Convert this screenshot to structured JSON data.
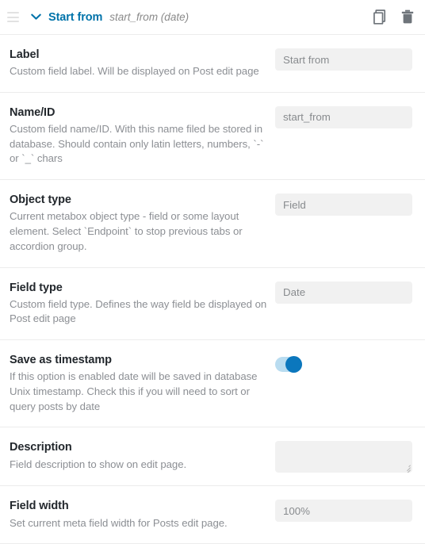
{
  "header": {
    "drag_handle_icon": "drag-handle-icon",
    "collapse_icon": "chevron-down-icon",
    "title": "Start from",
    "subtitle": "start_from (date)",
    "duplicate_icon": "duplicate-icon",
    "delete_icon": "trash-icon",
    "title_color": "#0073aa",
    "subtitle_color": "#8a8a8a"
  },
  "rows": [
    {
      "label": "Label",
      "description": "Custom field label. Will be displayed on Post edit page",
      "control": "text",
      "name": "label",
      "value": "Start from",
      "placeholder": "Start from"
    },
    {
      "label": "Name/ID",
      "description": "Custom field name/ID. With this name filed be stored in database. Should contain only latin letters, numbers, `-` or `_` chars",
      "control": "text",
      "name": "name-id",
      "value": "start_from",
      "placeholder": "start_from"
    },
    {
      "label": "Object type",
      "description": "Current metabox object type - field or some layout element. Select `Endpoint` to stop previous tabs or accordion group.",
      "control": "select",
      "name": "object-type",
      "value": "Field",
      "placeholder": "Field"
    },
    {
      "label": "Field type",
      "description": "Custom field type. Defines the way field be displayed on Post edit page",
      "control": "select",
      "name": "field-type",
      "value": "Date",
      "placeholder": "Date"
    },
    {
      "label": "Save as timestamp",
      "description": "If this option is enabled date will be saved in database Unix timestamp. Check this if you will need to sort or query posts by date",
      "control": "toggle",
      "name": "save-as-timestamp",
      "value": "on"
    },
    {
      "label": "Description",
      "description": "Field description to show on edit page.",
      "control": "textarea",
      "name": "description",
      "value": "",
      "placeholder": ""
    },
    {
      "label": "Field width",
      "description": "Set current meta field width for Posts edit page.",
      "control": "text",
      "name": "field-width",
      "value": "100%",
      "placeholder": "100%"
    }
  ],
  "colors": {
    "accent": "#0073aa",
    "toggle_on_track": "#b9dcf0",
    "toggle_on_knob": "#0b77bd",
    "input_background": "#f1f1f1",
    "separator": "#ececec"
  }
}
